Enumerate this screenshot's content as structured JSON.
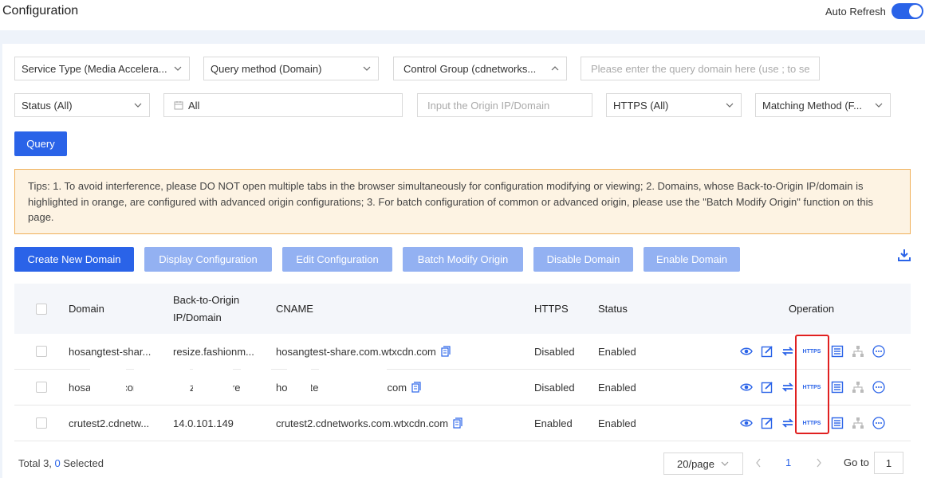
{
  "header": {
    "title": "Configuration",
    "auto_refresh_label": "Auto Refresh",
    "auto_refresh_on": true
  },
  "filters": {
    "service_type": "Service Type (Media Accelera...",
    "query_method": "Query method (Domain)",
    "control_group": "Control Group (cdnetworks...",
    "domain_placeholder": "Please enter the query domain here (use ; to se",
    "status": "Status (All)",
    "date_range": "All",
    "origin_placeholder": "Input the Origin IP/Domain",
    "https": "HTTPS (All)",
    "matching_method": "Matching Method (F...",
    "query_button": "Query"
  },
  "tips": "Tips: 1. To avoid interference, please DO NOT open multiple tabs in the browser simultaneously for configuration modifying or viewing; 2. Domains, whose Back-to-Origin IP/domain is highlighted in orange, are configured with advanced origin configurations; 3. For batch configuration of common or advanced origin, please use the \"Batch Modify Origin\" function on this page.",
  "actions": {
    "create": "Create New Domain",
    "display": "Display Configuration",
    "edit": "Edit Configuration",
    "batch_modify": "Batch Modify Origin",
    "disable": "Disable Domain",
    "enable": "Enable Domain"
  },
  "table": {
    "headers": {
      "domain": "Domain",
      "origin_line1": "Back-to-Origin",
      "origin_line2": "IP/Domain",
      "cname": "CNAME",
      "https": "HTTPS",
      "status": "Status",
      "operation": "Operation"
    },
    "https_icon_label": "HTTPS",
    "rows": [
      {
        "domain": "hosangtest-shar...",
        "origin": "resize.fashionm...",
        "cname": "hosangtest-share.com.wtxcdn.com",
        "https": "Disabled",
        "status": "Enabled"
      },
      {
        "domain": "hosangtest.com....",
        "origin": "resize.eqlstore.c...",
        "cname": "hosangtest.com.wtxcdn.com",
        "https": "Disabled",
        "status": "Enabled"
      },
      {
        "domain": "crutest2.cdnetw...",
        "origin": "14.0.101.149",
        "cname": "crutest2.cdnetworks.com.wtxcdn.com",
        "https": "Enabled",
        "status": "Enabled"
      }
    ]
  },
  "footer": {
    "total_prefix": "Total 3, ",
    "selected_count": "0",
    "selected_suffix": " Selected",
    "page_size": "20/page",
    "current_page": "1",
    "goto_label": "Go to",
    "goto_value": "1"
  },
  "colors": {
    "primary": "#2a63e8",
    "disabled_button": "#93b1f2",
    "tips_border": "#f0b05a",
    "highlight": "#e02020"
  }
}
